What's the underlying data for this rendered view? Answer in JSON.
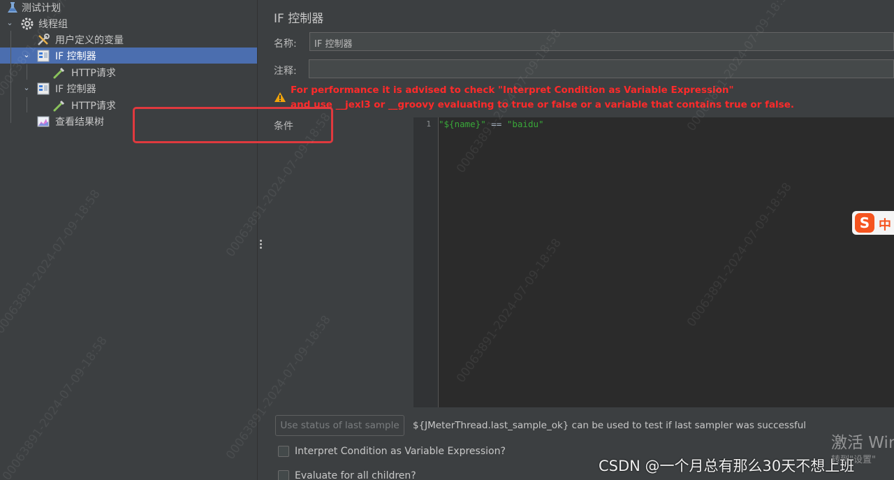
{
  "tree": {
    "items": [
      {
        "label": "测试计划",
        "icon": "flask-icon"
      },
      {
        "label": "线程组",
        "icon": "gear-icon"
      },
      {
        "label": "用户定义的变量",
        "icon": "wrench-icon"
      },
      {
        "label": "IF 控制器",
        "icon": "controller-icon",
        "selected": true
      },
      {
        "label": "HTTP请求",
        "icon": "pipette-icon"
      },
      {
        "label": "IF 控制器",
        "icon": "controller-icon"
      },
      {
        "label": "HTTP请求",
        "icon": "pipette-icon"
      },
      {
        "label": "查看结果树",
        "icon": "chart-icon"
      }
    ]
  },
  "panel": {
    "title": "IF 控制器",
    "name_label": "名称:",
    "name_value": "IF 控制器",
    "comment_label": "注释:",
    "comment_value": "",
    "warning_line1": "For performance it is advised to check \"Interpret Condition as Variable Expression\"",
    "warning_line2": "and use __jexl3 or __groovy evaluating to true or false or a variable that contains true or false.",
    "condition_label": "条件",
    "editor": {
      "line_number": "1",
      "code_left": "\"${name}\"",
      "code_op": " == ",
      "code_right": "\"baidu\""
    },
    "use_status_button": "Use status of last sample",
    "hint_text": "${JMeterThread.last_sample_ok} can be used to test if last sampler was successful",
    "checkbox_interpret": "Interpret Condition as Variable Expression?",
    "checkbox_evaluate": "Evaluate for all children?"
  },
  "overlay": {
    "watermark_text": "00063891-2024-07-09-18:58",
    "ime_label": "中",
    "activate_title": "激活 Wir",
    "activate_sub": "转到\"设置\"",
    "csdn_label": "CSDN @一个月总有那么30天不想上班"
  },
  "colors": {
    "selection": "#4b6eaf",
    "warning": "#ff2a2a",
    "highlight_box": "#e0393e",
    "code_string": "#39a839"
  }
}
